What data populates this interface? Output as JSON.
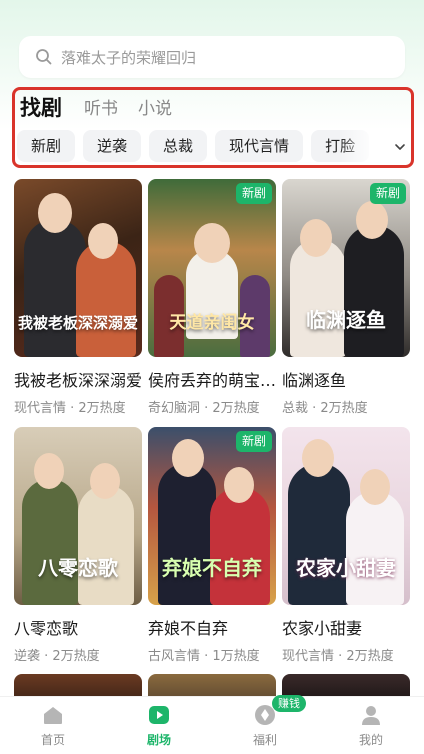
{
  "search": {
    "placeholder": "落难太子的荣耀回归"
  },
  "tabs": [
    {
      "label": "找剧",
      "active": true
    },
    {
      "label": "听书",
      "active": false
    },
    {
      "label": "小说",
      "active": false
    }
  ],
  "chips": [
    "新剧",
    "逆袭",
    "总裁",
    "现代言情",
    "打脸"
  ],
  "badge_new": "新剧",
  "cards": [
    {
      "title": "我被老板深深溺爱",
      "art": "我被老板深深溺爱",
      "meta": "现代言情 · 2万热度",
      "new": false
    },
    {
      "title": "侯府丢弃的萌宝是天道亲闺女",
      "art": "天道亲闺女",
      "meta": "奇幻脑洞 · 2万热度",
      "new": true
    },
    {
      "title": "临渊逐鱼",
      "art": "临渊逐鱼",
      "meta": "总裁 · 2万热度",
      "new": true
    },
    {
      "title": "八零恋歌",
      "art": "八零恋歌",
      "meta": "逆袭 · 2万热度",
      "new": false
    },
    {
      "title": "弃娘不自弃",
      "art": "弃娘不自弃",
      "meta": "古风言情 · 1万热度",
      "new": true
    },
    {
      "title": "农家小甜妻",
      "art": "农家小甜妻",
      "meta": "现代言情 · 2万热度",
      "new": false
    }
  ],
  "nav": [
    {
      "label": "首页",
      "icon": "home-icon",
      "active": false
    },
    {
      "label": "剧场",
      "icon": "play-icon",
      "active": true
    },
    {
      "label": "福利",
      "icon": "coin-icon",
      "active": false,
      "badge": "赚钱"
    },
    {
      "label": "我的",
      "icon": "user-icon",
      "active": false
    }
  ],
  "colors": {
    "accent": "#1db56a",
    "highlight_border": "#d9342b"
  }
}
